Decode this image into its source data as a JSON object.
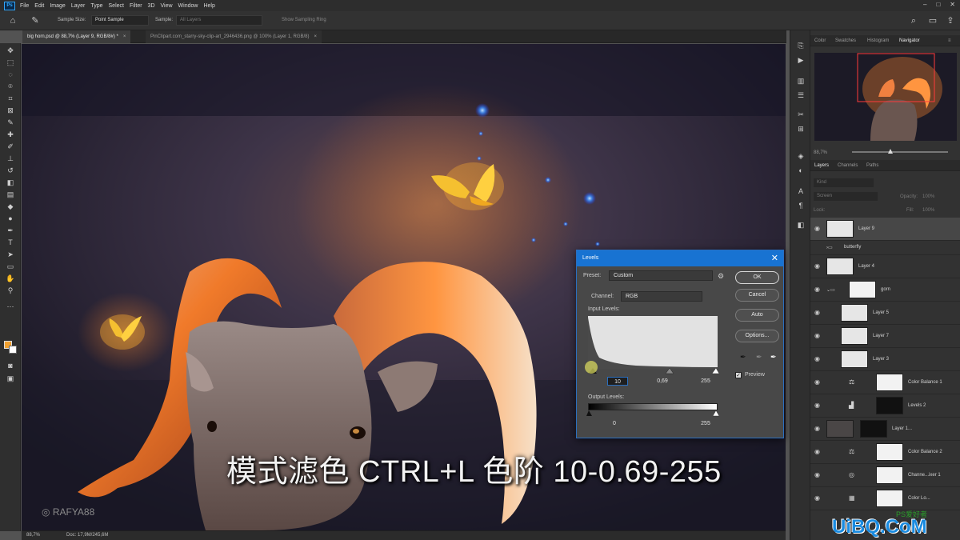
{
  "app": {
    "logo_text": "Ps",
    "menu": [
      "File",
      "Edit",
      "Image",
      "Layer",
      "Type",
      "Select",
      "Filter",
      "3D",
      "View",
      "Window",
      "Help"
    ],
    "window_controls": [
      "–",
      "□",
      "✕"
    ]
  },
  "options": {
    "sample_size_label": "Sample Size:",
    "sample_size_value": "Point Sample",
    "sample_label": "Sample:",
    "sample_value": "All Layers",
    "show_ring": "Show Sampling Ring"
  },
  "tabs": [
    {
      "label": "big horn.psd @ 88,7% (Layer 9, RGB/8#) *"
    },
    {
      "label": "PinClipart.com_starry-sky-clip-art_2946436.png @ 100% (Layer 1, RGB/8)"
    }
  ],
  "status": {
    "zoom": "88,7%",
    "doc": "Doc: 17,9M/245,6M"
  },
  "overlay": {
    "subtitle": "模式滤色 CTRL+L 色阶 10-0.69-255",
    "watermark": "RAFYA88",
    "site": "UiBQ.CoM",
    "site_badge": "PS爱好者"
  },
  "levels": {
    "title": "Levels",
    "preset_label": "Preset:",
    "preset_value": "Custom",
    "channel_label": "Channel:",
    "channel_value": "RGB",
    "input_label": "Input Levels:",
    "input_black": "10",
    "input_gamma": "0,69",
    "input_white": "255",
    "output_label": "Output Levels:",
    "output_black": "0",
    "output_white": "255",
    "buttons": {
      "ok": "OK",
      "cancel": "Cancel",
      "auto": "Auto",
      "options": "Options..."
    },
    "preview_label": "Preview",
    "preview_checked": true,
    "accent": "#1873d2"
  },
  "navigator": {
    "tabs": [
      "Color",
      "Swatches",
      "Histogram",
      "Navigator"
    ],
    "active": "Navigator",
    "zoom": "88,7%"
  },
  "layers_panel": {
    "tabs": [
      "Layers",
      "Channels",
      "Paths"
    ],
    "active": "Layers",
    "filter_placeholder": "Kind",
    "blend_mode": "Screen",
    "opacity_label": "Opacity:",
    "opacity_value": "100%",
    "lock_label": "Lock:",
    "fill_label": "Fill:",
    "fill_value": "100%",
    "layers": [
      {
        "name": "Layer 9",
        "selected": true
      },
      {
        "name": "butterfly",
        "group": true
      },
      {
        "name": "Layer 4"
      },
      {
        "name": "gorn",
        "group": true
      },
      {
        "name": "Layer 5"
      },
      {
        "name": "Layer 7"
      },
      {
        "name": "Layer 3"
      },
      {
        "name": "Color Balance 1"
      },
      {
        "name": "Levels 2"
      },
      {
        "name": "Layer 1..."
      },
      {
        "name": "Color Balance 2"
      },
      {
        "name": "Channe...ixer 1"
      },
      {
        "name": "Color Lo..."
      }
    ]
  }
}
